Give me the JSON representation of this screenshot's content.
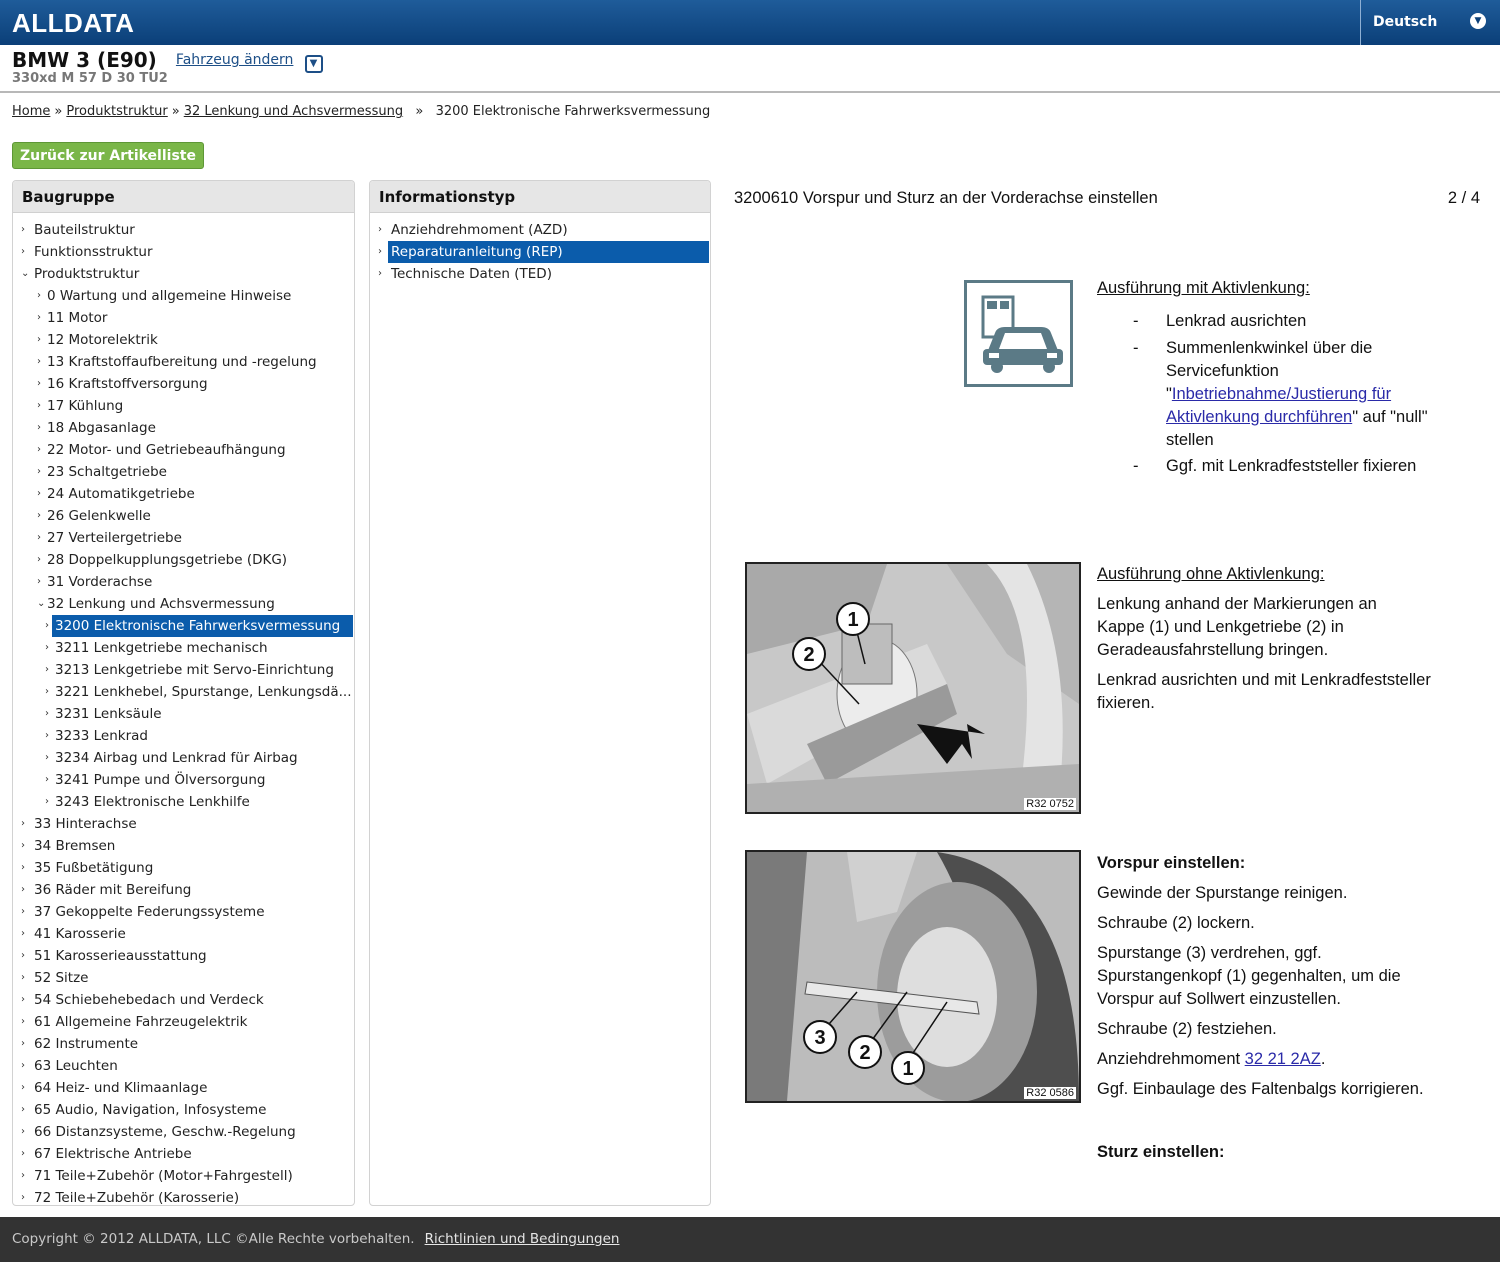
{
  "header": {
    "logo": "ALLDATA",
    "language": "Deutsch"
  },
  "vehicle": {
    "model": "BMW 3 (E90)",
    "change_link": "Fahrzeug ändern",
    "engine": "330xd M 57 D 30 TU2"
  },
  "breadcrumb": [
    "Home",
    "Produktstruktur",
    "32 Lenkung und Achsvermessung",
    "3200 Elektronische Fahrwerksvermessung"
  ],
  "back_button": "Zurück zur Artikelliste",
  "baugruppe": {
    "title": "Baugruppe",
    "items": [
      {
        "label": "Bauteilstruktur",
        "level": 0,
        "arrow": "›"
      },
      {
        "label": "Funktionsstruktur",
        "level": 0,
        "arrow": "›"
      },
      {
        "label": "Produktstruktur",
        "level": 0,
        "arrow": "⌄"
      },
      {
        "label": "0 Wartung und allgemeine Hinweise",
        "level": 1,
        "arrow": "›"
      },
      {
        "label": "11 Motor",
        "level": 1,
        "arrow": "›"
      },
      {
        "label": "12 Motorelektrik",
        "level": 1,
        "arrow": "›"
      },
      {
        "label": "13 Kraftstoffaufbereitung und -regelung",
        "level": 1,
        "arrow": "›"
      },
      {
        "label": "16 Kraftstoffversorgung",
        "level": 1,
        "arrow": "›"
      },
      {
        "label": "17 Kühlung",
        "level": 1,
        "arrow": "›"
      },
      {
        "label": "18 Abgasanlage",
        "level": 1,
        "arrow": "›"
      },
      {
        "label": "22 Motor- und Getriebeaufhängung",
        "level": 1,
        "arrow": "›"
      },
      {
        "label": "23 Schaltgetriebe",
        "level": 1,
        "arrow": "›"
      },
      {
        "label": "24 Automatikgetriebe",
        "level": 1,
        "arrow": "›"
      },
      {
        "label": "26 Gelenkwelle",
        "level": 1,
        "arrow": "›"
      },
      {
        "label": "27 Verteilergetriebe",
        "level": 1,
        "arrow": "›"
      },
      {
        "label": "28 Doppelkupplungsgetriebe (DKG)",
        "level": 1,
        "arrow": "›"
      },
      {
        "label": "31 Vorderachse",
        "level": 1,
        "arrow": "›"
      },
      {
        "label": "32 Lenkung und Achsvermessung",
        "level": 1,
        "arrow": "⌄"
      },
      {
        "label": "3200 Elektronische Fahrwerksvermessung",
        "level": 2,
        "arrow": "›",
        "selected": true
      },
      {
        "label": "3211 Lenkgetriebe mechanisch",
        "level": 2,
        "arrow": "›"
      },
      {
        "label": "3213 Lenkgetriebe mit Servo-Einrichtung",
        "level": 2,
        "arrow": "›"
      },
      {
        "label": "3221 Lenkhebel, Spurstange, Lenkungsdä...",
        "level": 2,
        "arrow": "›"
      },
      {
        "label": "3231 Lenksäule",
        "level": 2,
        "arrow": "›"
      },
      {
        "label": "3233 Lenkrad",
        "level": 2,
        "arrow": "›"
      },
      {
        "label": "3234 Airbag und Lenkrad für Airbag",
        "level": 2,
        "arrow": "›"
      },
      {
        "label": "3241 Pumpe und Ölversorgung",
        "level": 2,
        "arrow": "›"
      },
      {
        "label": "3243 Elektronische Lenkhilfe",
        "level": 2,
        "arrow": "›"
      },
      {
        "label": "33 Hinterachse",
        "level": 0,
        "arrow": "›"
      },
      {
        "label": "34 Bremsen",
        "level": 0,
        "arrow": "›"
      },
      {
        "label": "35 Fußbetätigung",
        "level": 0,
        "arrow": "›"
      },
      {
        "label": "36 Räder mit Bereifung",
        "level": 0,
        "arrow": "›"
      },
      {
        "label": "37 Gekoppelte Federungssysteme",
        "level": 0,
        "arrow": "›"
      },
      {
        "label": "41 Karosserie",
        "level": 0,
        "arrow": "›"
      },
      {
        "label": "51 Karosserieausstattung",
        "level": 0,
        "arrow": "›"
      },
      {
        "label": "52 Sitze",
        "level": 0,
        "arrow": "›"
      },
      {
        "label": "54 Schiebehebedach und Verdeck",
        "level": 0,
        "arrow": "›"
      },
      {
        "label": "61 Allgemeine Fahrzeugelektrik",
        "level": 0,
        "arrow": "›"
      },
      {
        "label": "62 Instrumente",
        "level": 0,
        "arrow": "›"
      },
      {
        "label": "63 Leuchten",
        "level": 0,
        "arrow": "›"
      },
      {
        "label": "64 Heiz- und Klimaanlage",
        "level": 0,
        "arrow": "›"
      },
      {
        "label": "65 Audio, Navigation, Infosysteme",
        "level": 0,
        "arrow": "›"
      },
      {
        "label": "66 Distanzsysteme, Geschw.-Regelung",
        "level": 0,
        "arrow": "›"
      },
      {
        "label": "67 Elektrische Antriebe",
        "level": 0,
        "arrow": "›"
      },
      {
        "label": "71 Teile+Zubehör (Motor+Fahrgestell)",
        "level": 0,
        "arrow": "›"
      },
      {
        "label": "72 Teile+Zubehör (Karosserie)",
        "level": 0,
        "arrow": "›"
      }
    ]
  },
  "infotyp": {
    "title": "Informationstyp",
    "items": [
      {
        "label": "Anziehdrehmoment (AZD)",
        "arrow": "›"
      },
      {
        "label": "Reparaturanleitung (REP)",
        "arrow": "›",
        "selected": true
      },
      {
        "label": "Technische Daten (TED)",
        "arrow": "›"
      }
    ]
  },
  "content": {
    "title": "3200610 Vorspur und Sturz an der Vorderachse einstellen",
    "page": "2 / 4",
    "s1": {
      "heading": "Ausführung mit Aktivlenkung:",
      "b1": "Lenkrad ausrichten",
      "b2_pre": "Summenlenkwinkel über die Servicefunktion \"",
      "b2_link": "Inbetriebnahme/Justierung für Aktivlenkung durchführen",
      "b2_post": "\" auf \"null\" stellen",
      "b3": "Ggf. mit Lenkradfeststeller fixieren",
      "dash": "-"
    },
    "s2": {
      "heading": "Ausführung ohne Aktivlenkung:",
      "p1": "Lenkung anhand der Markierungen an Kappe (1) und Lenkgetriebe (2) in Geradeausfahrstellung bringen.",
      "p2": "Lenkrad ausrichten und mit Lenkradfeststeller fixieren.",
      "image_tag": "R32 0752",
      "callouts": [
        "1",
        "2"
      ]
    },
    "s3": {
      "heading": "Vorspur einstellen:",
      "p1": "Gewinde der Spurstange reinigen.",
      "p2": "Schraube (2) lockern.",
      "p3": "Spurstange (3) verdrehen, ggf. Spurstangenkopf (1) gegenhalten, um die Vorspur auf Sollwert einzustellen.",
      "p4": "Schraube (2) festziehen.",
      "p5_pre": "Anziehdrehmoment ",
      "p5_link": "32 21 2AZ",
      "p5_post": ".",
      "p6": "Ggf. Einbaulage des Faltenbalgs korrigieren.",
      "image_tag": "R32 0586",
      "callouts": [
        "3",
        "2",
        "1"
      ]
    },
    "s4": {
      "heading": "Sturz einstellen:"
    }
  },
  "footer": {
    "copyright": "Copyright ©  2012 ALLDATA,   LLC ©Alle Rechte vorbehalten.",
    "link": "Richtlinien und Bedingungen"
  }
}
